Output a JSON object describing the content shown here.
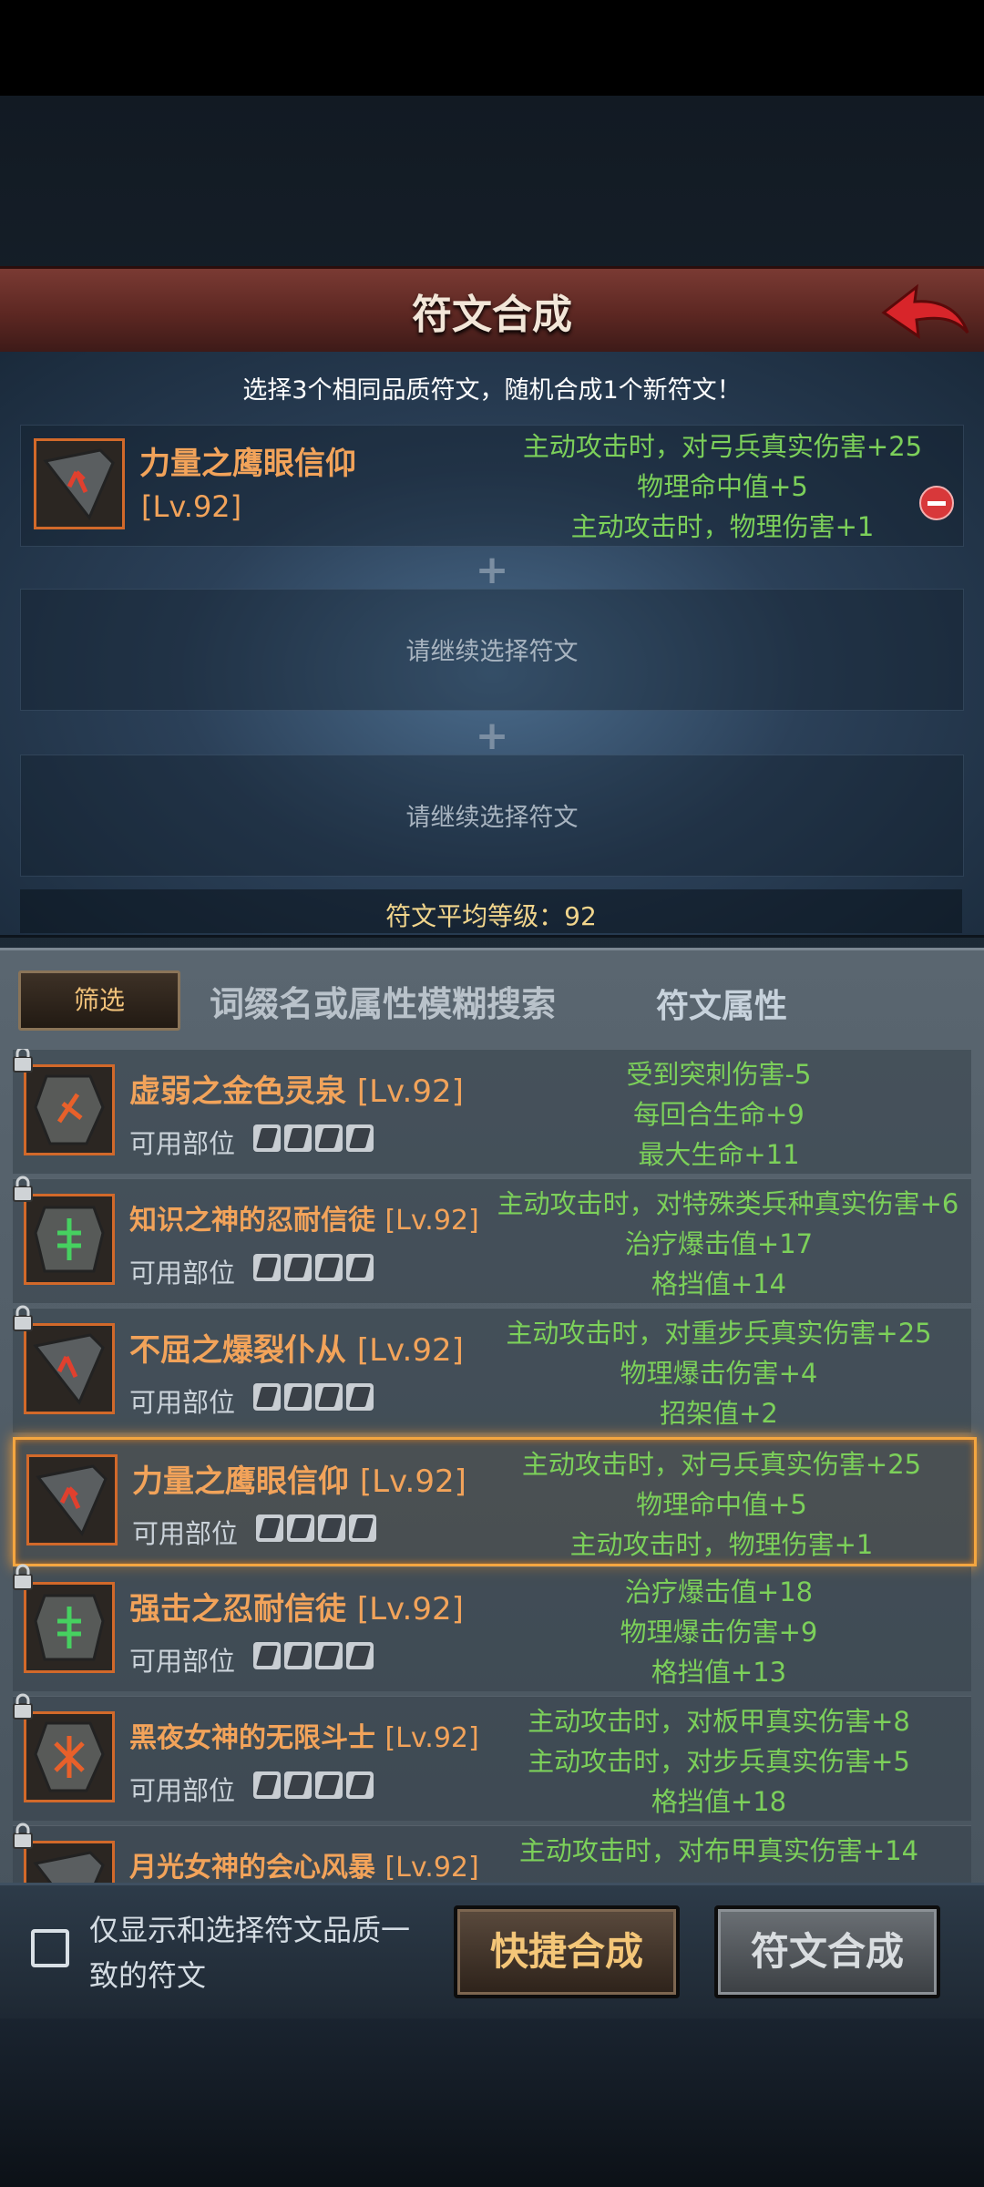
{
  "header": {
    "title": "符文合成"
  },
  "compose": {
    "instruction": "选择3个相同品质符文，随机合成1个新符文！",
    "selected_rune": {
      "name": "力量之鹰眼信仰",
      "level": "[Lv.92]",
      "attrs": [
        "主动攻击时，对弓兵真实伤害+25",
        "物理命中值+5",
        "主动攻击时，物理伤害+1"
      ]
    },
    "empty_slot_hint": "请继续选择符文",
    "plus_symbol": "+",
    "avg_level_label": "符文平均等级：92"
  },
  "filter": {
    "button_label": "筛选",
    "search_placeholder": "词缀名或属性模糊搜索",
    "attr_tab_label": "符文属性"
  },
  "rune_list": {
    "parts_label": "可用部位",
    "items": [
      {
        "name": "虚弱之金色灵泉",
        "level": "[Lv.92]",
        "attrs": [
          "受到突刺伤害-5",
          "每回合生命+9",
          "最大生命+11"
        ]
      },
      {
        "name": "知识之神的忍耐信徒",
        "level": "[Lv.92]",
        "attrs": [
          "主动攻击时，对特殊类兵种真实伤害+6",
          "治疗爆击值+17",
          "格挡值+14"
        ]
      },
      {
        "name": "不屈之爆裂仆从",
        "level": "[Lv.92]",
        "attrs": [
          "主动攻击时，对重步兵真实伤害+25",
          "物理爆击伤害+4",
          "招架值+2"
        ]
      },
      {
        "name": "力量之鹰眼信仰",
        "level": "[Lv.92]",
        "attrs": [
          "主动攻击时，对弓兵真实伤害+25",
          "物理命中值+5",
          "主动攻击时，物理伤害+1"
        ]
      },
      {
        "name": "强击之忍耐信徒",
        "level": "[Lv.92]",
        "attrs": [
          "治疗爆击值+18",
          "物理爆击伤害+9",
          "格挡值+13"
        ]
      },
      {
        "name": "黑夜女神的无限斗士",
        "level": "[Lv.92]",
        "attrs": [
          "主动攻击时，对板甲真实伤害+8",
          "主动攻击时，对步兵真实伤害+5",
          "格挡值+18"
        ]
      },
      {
        "name": "月光女神的会心风暴",
        "level": "[Lv.92]",
        "attrs": [
          "主动攻击时，对布甲真实伤害+14"
        ]
      }
    ]
  },
  "footer": {
    "checkbox_label": "仅显示和选择符文品质一致的符文",
    "quick_button": "快捷合成",
    "merge_button": "符文合成"
  },
  "colors": {
    "rune_name": "#f2a35a",
    "attr_text": "#7cd05a",
    "selected_border": "#f4a640",
    "header": "#6b302a"
  }
}
